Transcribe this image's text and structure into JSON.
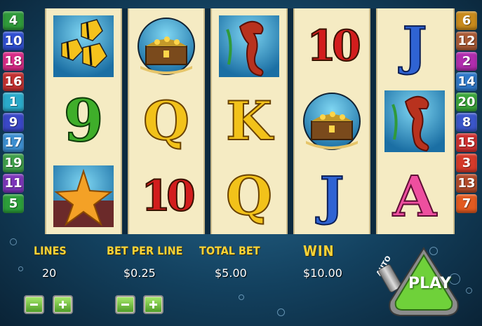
{
  "left_lines": [
    {
      "n": "4",
      "color": "#2f9a3a"
    },
    {
      "n": "10",
      "color": "#2f4fd1"
    },
    {
      "n": "18",
      "color": "#d82b86"
    },
    {
      "n": "16",
      "color": "#c23030"
    },
    {
      "n": "1",
      "color": "#2aa9c9"
    },
    {
      "n": "9",
      "color": "#3a47c6"
    },
    {
      "n": "17",
      "color": "#3c8ed0"
    },
    {
      "n": "19",
      "color": "#3e9e4a"
    },
    {
      "n": "11",
      "color": "#7b35b8"
    },
    {
      "n": "5",
      "color": "#2c9e3a"
    }
  ],
  "right_lines": [
    {
      "n": "6",
      "color": "#c88a1c"
    },
    {
      "n": "12",
      "color": "#a85a35"
    },
    {
      "n": "2",
      "color": "#b02cae"
    },
    {
      "n": "14",
      "color": "#2f78c8"
    },
    {
      "n": "20",
      "color": "#3aa53a"
    },
    {
      "n": "8",
      "color": "#3a56c9"
    },
    {
      "n": "15",
      "color": "#cc3030"
    },
    {
      "n": "3",
      "color": "#d43a2a"
    },
    {
      "n": "13",
      "color": "#b04a2a"
    },
    {
      "n": "7",
      "color": "#e25a20"
    }
  ],
  "reels": [
    [
      "fish-picture",
      "9",
      "starfish-picture"
    ],
    [
      "treasure-chest-picture",
      "Q",
      "10"
    ],
    [
      "seahorse-picture",
      "K",
      "Q"
    ],
    [
      "10",
      "treasure-chest-picture",
      "J"
    ],
    [
      "J",
      "seahorse-picture",
      "A"
    ]
  ],
  "card_labels": {
    "ten": "10",
    "nine": "9",
    "queen": "Q",
    "king": "K",
    "jack": "J",
    "ace": "A"
  },
  "panel": {
    "lines_label": "LINES",
    "lines_value": "20",
    "bet_label": "BET PER LINE",
    "bet_value": "$0.25",
    "total_label": "TOTAL BET",
    "total_value": "$5.00",
    "win_label": "WIN",
    "win_value": "$10.00",
    "auto_label": "AUTO",
    "play_label": "PLAY"
  }
}
